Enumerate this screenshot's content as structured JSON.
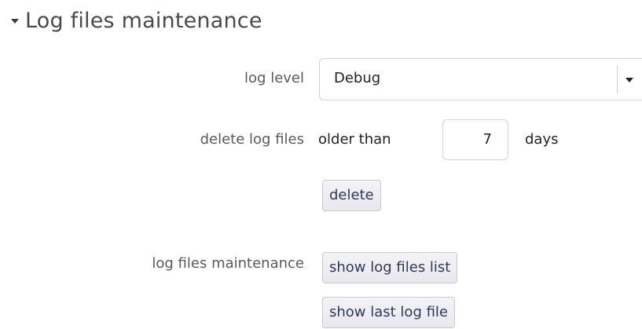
{
  "section": {
    "title": "Log files maintenance",
    "collapse_icon": "caret-down-icon"
  },
  "log_level": {
    "label": "log level",
    "selected": "Debug",
    "dropdown_icon": "caret-down-icon"
  },
  "delete_logs": {
    "label": "delete log files",
    "prefix": "older than",
    "days_value": "7",
    "suffix": "days",
    "delete_button": "delete"
  },
  "maintenance": {
    "label": "log files maintenance",
    "show_list_button": "show log files list",
    "show_last_button": "show last log file"
  }
}
